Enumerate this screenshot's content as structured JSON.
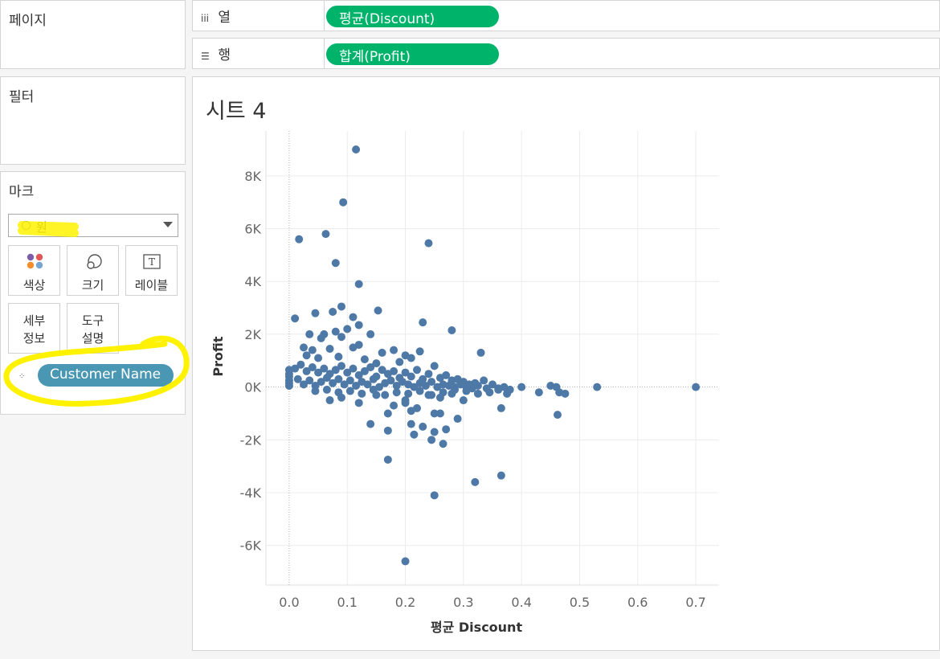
{
  "pages_title": "페이지",
  "filters_title": "필터",
  "marks": {
    "title": "마크",
    "mark_type": "원",
    "buttons": {
      "color": "색상",
      "size": "크기",
      "label": "레이블",
      "detail_line1": "세부",
      "detail_line2": "정보",
      "tooltip_line1": "도구",
      "tooltip_line2": "설명"
    },
    "detail_field": "Customer Name"
  },
  "shelves": {
    "columns_label": "열",
    "columns_pill": "평균(Discount)",
    "rows_label": "행",
    "rows_pill": "합계(Profit)"
  },
  "sheet_title": "시트 4",
  "colors": {
    "mark": "#4e79a7",
    "shelf_pill": "#00b36b",
    "detail_pill": "#4a97b4",
    "highlight": "#fff200"
  },
  "chart_data": {
    "type": "scatter",
    "xlabel": "평균 Discount",
    "ylabel": "Profit",
    "xlim": [
      -0.04,
      0.74
    ],
    "ylim": [
      -7500,
      9700
    ],
    "x_ticks": [
      0.0,
      0.1,
      0.2,
      0.3,
      0.4,
      0.5,
      0.6,
      0.7
    ],
    "x_tick_labels": [
      "0.0",
      "0.1",
      "0.2",
      "0.3",
      "0.4",
      "0.5",
      "0.6",
      "0.7"
    ],
    "y_ticks": [
      -6000,
      -4000,
      -2000,
      0,
      2000,
      4000,
      6000,
      8000
    ],
    "y_tick_labels": [
      "-6K",
      "-4K",
      "-2K",
      "0K",
      "2K",
      "4K",
      "6K",
      "8K"
    ],
    "grid": true,
    "points": [
      [
        0.115,
        9000
      ],
      [
        0.093,
        7000
      ],
      [
        0.063,
        5800
      ],
      [
        0.017,
        5600
      ],
      [
        0.24,
        5450
      ],
      [
        0.08,
        4700
      ],
      [
        0.12,
        3900
      ],
      [
        0.09,
        3050
      ],
      [
        0.075,
        2850
      ],
      [
        0.153,
        2900
      ],
      [
        0.01,
        2600
      ],
      [
        0.11,
        2650
      ],
      [
        0.045,
        2800
      ],
      [
        0.23,
        2450
      ],
      [
        0.28,
        2150
      ],
      [
        0.12,
        2350
      ],
      [
        0.035,
        2000
      ],
      [
        0.06,
        2000
      ],
      [
        0.08,
        2100
      ],
      [
        0.1,
        2200
      ],
      [
        0.14,
        2000
      ],
      [
        0.055,
        1850
      ],
      [
        0.09,
        1900
      ],
      [
        0.025,
        1500
      ],
      [
        0.04,
        1400
      ],
      [
        0.07,
        1450
      ],
      [
        0.12,
        1600
      ],
      [
        0.16,
        1300
      ],
      [
        0.18,
        1400
      ],
      [
        0.2,
        1200
      ],
      [
        0.225,
        1350
      ],
      [
        0.33,
        1300
      ],
      [
        0.11,
        1500
      ],
      [
        0.03,
        1200
      ],
      [
        0.05,
        1100
      ],
      [
        0.085,
        1150
      ],
      [
        0.13,
        1050
      ],
      [
        0.15,
        900
      ],
      [
        0.19,
        950
      ],
      [
        0.21,
        1100
      ],
      [
        0.0,
        650
      ],
      [
        0.0,
        500
      ],
      [
        0.0,
        400
      ],
      [
        0.0,
        250
      ],
      [
        0.0,
        150
      ],
      [
        0.0,
        50
      ],
      [
        0.01,
        700
      ],
      [
        0.02,
        850
      ],
      [
        0.03,
        600
      ],
      [
        0.04,
        750
      ],
      [
        0.05,
        550
      ],
      [
        0.06,
        700
      ],
      [
        0.07,
        500
      ],
      [
        0.08,
        650
      ],
      [
        0.09,
        800
      ],
      [
        0.1,
        550
      ],
      [
        0.11,
        700
      ],
      [
        0.12,
        450
      ],
      [
        0.13,
        600
      ],
      [
        0.14,
        750
      ],
      [
        0.15,
        400
      ],
      [
        0.16,
        650
      ],
      [
        0.17,
        500
      ],
      [
        0.18,
        600
      ],
      [
        0.19,
        350
      ],
      [
        0.2,
        550
      ],
      [
        0.21,
        400
      ],
      [
        0.22,
        650
      ],
      [
        0.23,
        300
      ],
      [
        0.24,
        500
      ],
      [
        0.25,
        800
      ],
      [
        0.26,
        350
      ],
      [
        0.27,
        450
      ],
      [
        0.28,
        250
      ],
      [
        0.29,
        300
      ],
      [
        0.3,
        200
      ],
      [
        0.31,
        100
      ],
      [
        0.32,
        150
      ],
      [
        0.335,
        250
      ],
      [
        0.35,
        100
      ],
      [
        0.015,
        300
      ],
      [
        0.025,
        100
      ],
      [
        0.035,
        250
      ],
      [
        0.045,
        50
      ],
      [
        0.055,
        200
      ],
      [
        0.065,
        350
      ],
      [
        0.075,
        150
      ],
      [
        0.085,
        300
      ],
      [
        0.095,
        100
      ],
      [
        0.105,
        250
      ],
      [
        0.115,
        50
      ],
      [
        0.125,
        200
      ],
      [
        0.135,
        100
      ],
      [
        0.145,
        300
      ],
      [
        0.155,
        0
      ],
      [
        0.165,
        150
      ],
      [
        0.175,
        250
      ],
      [
        0.185,
        50
      ],
      [
        0.195,
        200
      ],
      [
        0.205,
        100
      ],
      [
        0.215,
        0
      ],
      [
        0.225,
        150
      ],
      [
        0.235,
        50
      ],
      [
        0.245,
        200
      ],
      [
        0.255,
        0
      ],
      [
        0.265,
        100
      ],
      [
        0.275,
        50
      ],
      [
        0.285,
        0
      ],
      [
        0.295,
        100
      ],
      [
        0.305,
        0
      ],
      [
        0.315,
        -50
      ],
      [
        0.325,
        50
      ],
      [
        0.34,
        -50
      ],
      [
        0.36,
        -100
      ],
      [
        0.37,
        0
      ],
      [
        0.38,
        -100
      ],
      [
        0.045,
        -150
      ],
      [
        0.065,
        -100
      ],
      [
        0.085,
        -200
      ],
      [
        0.105,
        -150
      ],
      [
        0.125,
        -250
      ],
      [
        0.145,
        -100
      ],
      [
        0.165,
        -300
      ],
      [
        0.185,
        -200
      ],
      [
        0.205,
        -250
      ],
      [
        0.225,
        -150
      ],
      [
        0.245,
        -300
      ],
      [
        0.265,
        -200
      ],
      [
        0.285,
        -100
      ],
      [
        0.305,
        -150
      ],
      [
        0.325,
        -250
      ],
      [
        0.345,
        -200
      ],
      [
        0.07,
        -500
      ],
      [
        0.09,
        -400
      ],
      [
        0.12,
        -600
      ],
      [
        0.15,
        -300
      ],
      [
        0.18,
        -700
      ],
      [
        0.2,
        -500
      ],
      [
        0.22,
        -800
      ],
      [
        0.24,
        -300
      ],
      [
        0.26,
        -400
      ],
      [
        0.28,
        -250
      ],
      [
        0.3,
        -500
      ],
      [
        0.2,
        -600
      ],
      [
        0.17,
        -1000
      ],
      [
        0.21,
        -900
      ],
      [
        0.25,
        -1000
      ],
      [
        0.26,
        -1000
      ],
      [
        0.29,
        -1200
      ],
      [
        0.14,
        -1400
      ],
      [
        0.17,
        -1650
      ],
      [
        0.21,
        -1400
      ],
      [
        0.23,
        -1500
      ],
      [
        0.27,
        -1600
      ],
      [
        0.25,
        -1700
      ],
      [
        0.215,
        -1800
      ],
      [
        0.245,
        -2000
      ],
      [
        0.265,
        -2150
      ],
      [
        0.17,
        -2750
      ],
      [
        0.32,
        -3600
      ],
      [
        0.365,
        -3350
      ],
      [
        0.25,
        -4100
      ],
      [
        0.2,
        -6600
      ],
      [
        0.4,
        0
      ],
      [
        0.43,
        -200
      ],
      [
        0.45,
        50
      ],
      [
        0.46,
        0
      ],
      [
        0.465,
        -200
      ],
      [
        0.475,
        -250
      ],
      [
        0.462,
        -1050
      ],
      [
        0.53,
        0
      ],
      [
        0.7,
        0
      ],
      [
        0.365,
        -800
      ],
      [
        0.36,
        -50
      ],
      [
        0.375,
        -250
      ]
    ]
  }
}
